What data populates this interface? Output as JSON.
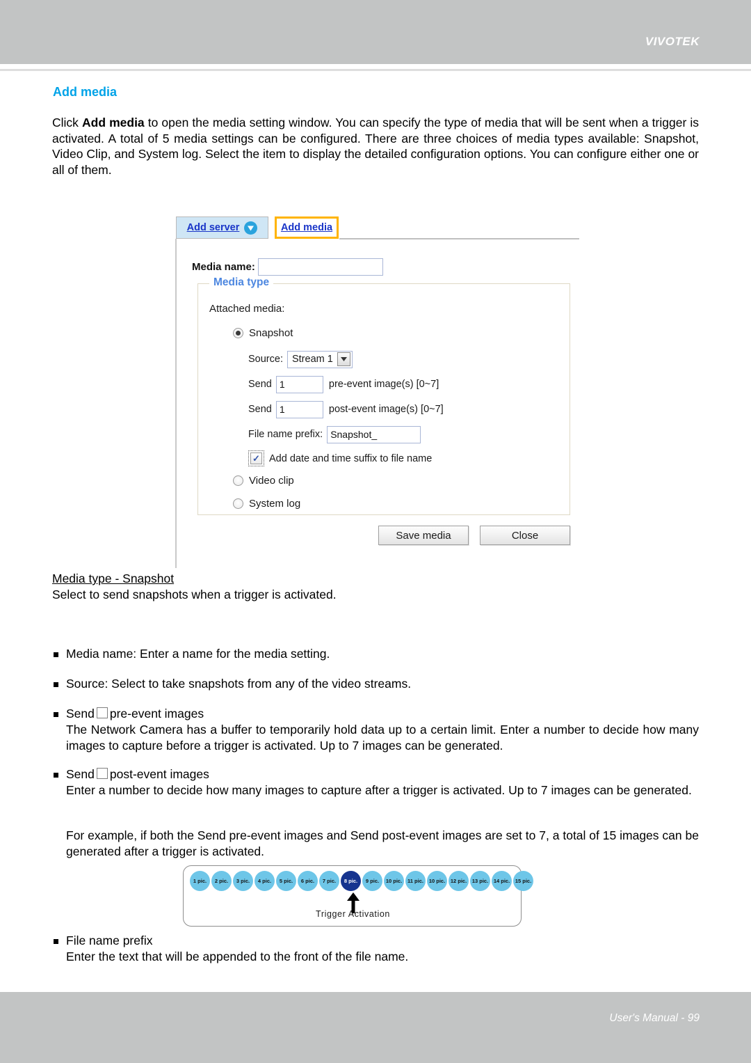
{
  "header": {
    "brand": "VIVOTEK"
  },
  "footer": {
    "manual_text": "User's Manual - 99"
  },
  "page": {
    "section_title": "Add media",
    "intro_prefix": "Click ",
    "intro_bold": "Add media",
    "intro_rest": " to open the media setting window. You can specify the type of media that will be sent when a trigger is activated. A total of 5 media settings can be configured. There are three choices of media types available: Snapshot, Video Clip, and System log. Select the item to display the detailed configuration options. You can configure either one or all of them."
  },
  "dialog": {
    "tab_add_server": "Add server",
    "tab_add_media": "Add media",
    "media_name_label": "Media name:",
    "media_name_value": "",
    "fieldset_legend": "Media type",
    "attached_media_label": "Attached media:",
    "radio_snapshot": "Snapshot",
    "radio_video_clip": "Video clip",
    "radio_system_log": "System log",
    "source_label": "Source:",
    "source_value": "Stream 1",
    "send_label": "Send",
    "pre_event_value": "1",
    "pre_event_trail": "pre-event image(s) [0~7]",
    "post_event_value": "1",
    "post_event_trail": "post-event image(s) [0~7]",
    "file_name_prefix_label": "File name prefix:",
    "file_name_prefix_value": "Snapshot_",
    "date_suffix_checkbox_label": "Add date and time suffix to file name",
    "save_button": "Save media",
    "close_button": "Close"
  },
  "caption": {
    "title": "Media type - Snapshot ",
    "description": "Select to send snapshots when a trigger is activated."
  },
  "bullets": {
    "media_name": "Media name: Enter a name for the media setting.",
    "source": "Source: Select to take snapshots from any of the video streams.",
    "send_pre_lead": "Send",
    "send_pre_trail": "pre-event images",
    "send_pre_body": "The Network Camera has a buffer to temporarily hold data up to a certain limit. Enter a number to decide how many images to capture before a trigger is activated. Up to 7 images can be generated.",
    "send_post_lead": "Send",
    "send_post_trail": "post-event images",
    "send_post_body": "Enter a number to decide how many images to capture after a trigger is activated. Up to 7 images can be generated.",
    "example_body": "For example, if both the Send pre-event images and Send post-event images are set to 7, a total of 15 images can be generated after a trigger is activated.",
    "file_name_prefix": "File name prefix",
    "file_name_prefix_body": "Enter the text that will be appended to the front of the file name."
  },
  "pic_diagram": {
    "circles": [
      "1 pic.",
      "2 pic.",
      "3 pic.",
      "4 pic.",
      "5 pic.",
      "6 pic.",
      "7 pic.",
      "8 pic.",
      "9 pic.",
      "10 pic.",
      "11 pic.",
      "10 pic.",
      "12 pic.",
      "13 pic.",
      "14 pic.",
      "15 pic."
    ],
    "active_index": 7,
    "trigger_label": "Trigger Activation",
    "circle_color": "#6ec6e8",
    "active_color": "#16348f"
  }
}
